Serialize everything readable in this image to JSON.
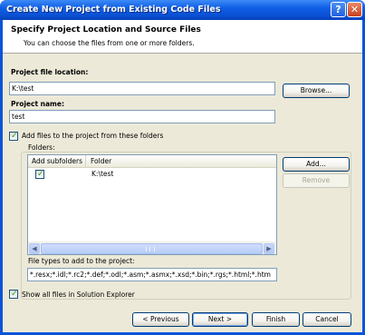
{
  "window": {
    "title": "Create New Project from Existing Code Files",
    "help_label": "?",
    "close_label": "✕"
  },
  "header": {
    "title": "Specify Project Location and Source Files",
    "subtitle": "You can choose the files from one or more folders."
  },
  "project_location": {
    "label": "Project file location:",
    "value": "K:\\test",
    "browse_label": "Browse..."
  },
  "project_name": {
    "label": "Project name:",
    "value": "test"
  },
  "add_files": {
    "label": "Add files to the project from these folders",
    "checked": true
  },
  "folders": {
    "label": "Folders:",
    "columns": [
      "Add subfolders",
      "Folder"
    ],
    "rows": [
      {
        "add_subfolders": true,
        "folder": "K:\\test"
      }
    ],
    "add_label": "Add...",
    "remove_label": "Remove"
  },
  "file_types": {
    "label": "File types to add to the project:",
    "value": "*.resx;*.idl;*.rc2;*.def;*.odl;*.asm;*.asmx;*.xsd;*.bin;*.rgs;*.html;*.htm"
  },
  "show_all": {
    "label": "Show all files in Solution Explorer",
    "checked": true
  },
  "footer": {
    "previous_label": "< Previous",
    "next_label": "Next >",
    "finish_label": "Finish",
    "cancel_label": "Cancel"
  },
  "icons": {
    "checkmark": "✓",
    "scroll_left": "◀",
    "scroll_right": "▶"
  }
}
